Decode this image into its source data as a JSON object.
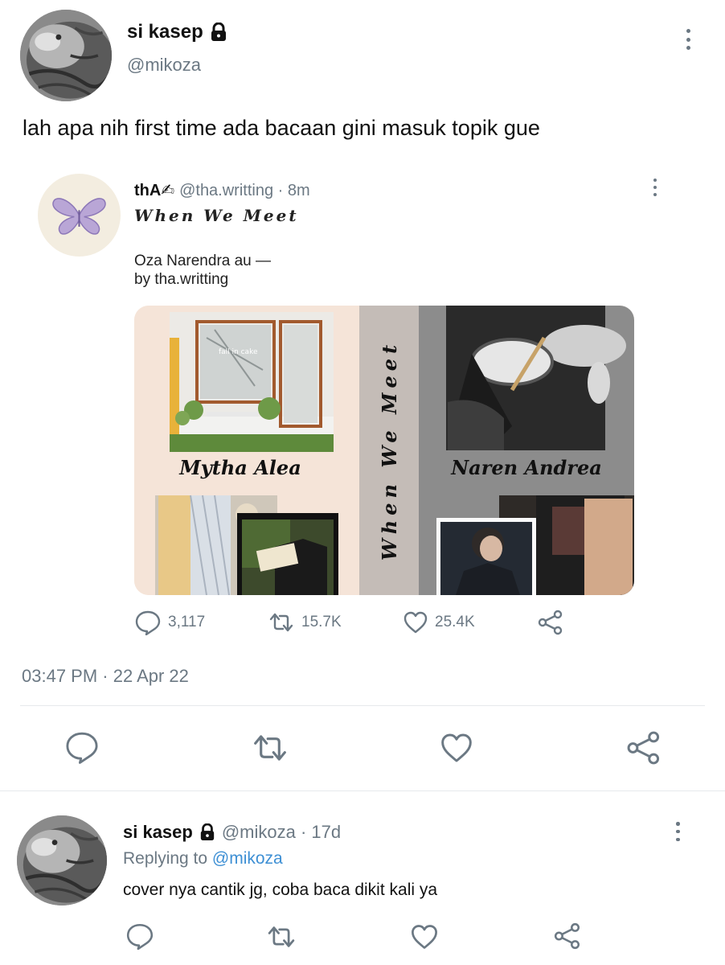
{
  "main_tweet": {
    "display_name": "si kasep",
    "handle": "@mikoza",
    "text": "lah apa nih first time ada bacaan gini masuk topik gue",
    "timestamp": "03:47 PM · 22 Apr 22",
    "icons": {
      "lock": "lock-icon",
      "more": "more-icon"
    }
  },
  "quoted": {
    "display_name": "thA✍",
    "meta": "@tha.writting · 8m",
    "subtitle": "When We Meet",
    "body_line1": "Oza Narendra au —",
    "body_line2": "by tha.writting",
    "media": {
      "left_name": "Mytha Alea",
      "center_title": "When We Meet",
      "right_name": "Naren Andrea",
      "shop_sign": "fall in cake"
    },
    "stats": {
      "replies": "3,117",
      "retweets": "15.7K",
      "likes": "25.4K"
    }
  },
  "reply": {
    "display_name": "si kasep",
    "handle_time": "@mikoza · 17d",
    "replying_prefix": "Replying to",
    "replying_to": "@mikoza",
    "text": "cover nya cantik jg, coba baca dikit kali ya"
  },
  "colors": {
    "muted": "#6b7883",
    "link": "#3d8fd4",
    "divider": "#e6e9ec"
  }
}
